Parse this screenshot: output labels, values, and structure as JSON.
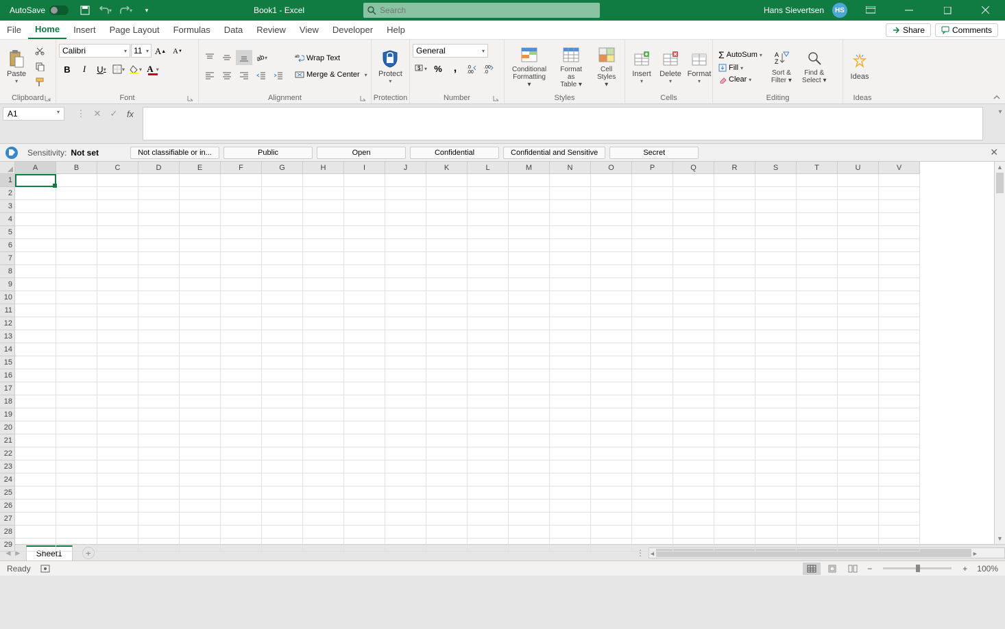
{
  "title_bar": {
    "autosave_label": "AutoSave",
    "autosave_state": "Off",
    "doc_title": "Book1 - Excel",
    "search_placeholder": "Search",
    "user_name": "Hans Sievertsen",
    "user_initials": "HS"
  },
  "tabs": {
    "file": "File",
    "home": "Home",
    "insert": "Insert",
    "page_layout": "Page Layout",
    "formulas": "Formulas",
    "data": "Data",
    "review": "Review",
    "view": "View",
    "developer": "Developer",
    "help": "Help",
    "share": "Share",
    "comments": "Comments"
  },
  "ribbon": {
    "clipboard": {
      "paste": "Paste",
      "label": "Clipboard"
    },
    "font": {
      "name": "Calibri",
      "size": "11",
      "label": "Font"
    },
    "alignment": {
      "wrap": "Wrap Text",
      "merge": "Merge & Center",
      "label": "Alignment"
    },
    "protection": {
      "protect": "Protect",
      "label": "Protection"
    },
    "number": {
      "format": "General",
      "label": "Number"
    },
    "styles": {
      "cond": "Conditional Formatting",
      "table": "Format as Table",
      "cell": "Cell Styles",
      "label": "Styles"
    },
    "cells": {
      "insert": "Insert",
      "delete": "Delete",
      "format": "Format",
      "label": "Cells"
    },
    "editing": {
      "autosum": "AutoSum",
      "fill": "Fill",
      "clear": "Clear",
      "sort": "Sort & Filter",
      "find": "Find & Select",
      "label": "Editing"
    },
    "ideas": {
      "ideas": "Ideas",
      "label": "Ideas"
    }
  },
  "name_box": "A1",
  "sensitivity": {
    "label": "Sensitivity:",
    "value": "Not set",
    "options": [
      "Not classifiable or in...",
      "Public",
      "Open",
      "Confidential",
      "Confidential and Sensitive",
      "Secret"
    ]
  },
  "columns": [
    "A",
    "B",
    "C",
    "D",
    "E",
    "F",
    "G",
    "H",
    "I",
    "J",
    "K",
    "L",
    "M",
    "N",
    "O",
    "P",
    "Q",
    "R",
    "S",
    "T",
    "U",
    "V"
  ],
  "rows": [
    1,
    2,
    3,
    4,
    5,
    6,
    7,
    8,
    9,
    10,
    11,
    12,
    13,
    14,
    15,
    16,
    17,
    18,
    19,
    20,
    21,
    22,
    23,
    24,
    25,
    26,
    27,
    28,
    29
  ],
  "sheet_tabs": {
    "active": "Sheet1"
  },
  "status": {
    "ready": "Ready",
    "zoom": "100%"
  }
}
